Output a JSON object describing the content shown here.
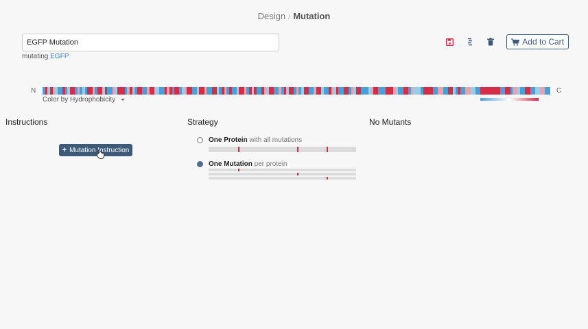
{
  "breadcrumb": {
    "parent": "Design",
    "separator": "/",
    "current": "Mutation"
  },
  "design": {
    "name_value": "EGFP Mutation",
    "mutating_prefix": "mutating",
    "mutating_target": "EGFP"
  },
  "toolbar": {
    "save_icon": "save-icon",
    "reorder_icon": "reorder-icon",
    "delete_icon": "trash-icon",
    "add_to_cart_label": "Add to Cart"
  },
  "sequence": {
    "n_label": "N",
    "c_label": "C",
    "color_by_label": "Color by Hydrophobicity",
    "colors": {
      "hydrophilic": "#4a9fd8",
      "neutral": "#ffffff",
      "hydrophobic": "#d62d46"
    },
    "pattern": "CTMTHMCCTCMTTCHCMCTTHCTTMTCCHMTTTCHTMCTTCCHTTMMCCTHTCTTCMHTTCCMTTHCCTTMCTHCTCCMTTHCTMTCCTHMTTCCHCTMTTCHCMTTCCHTTMCCTHMTCCTTCHMTTCCCMHTTCCCTTTHMCCTTCHMMMCTTTTCCHHCCTTMCTCCHHMMCCTTTTTTTTCCTTCHHMCCTTCCMMHHCC"
  },
  "columns": {
    "instructions_heading": "Instructions",
    "strategy_heading": "Strategy",
    "mutants_heading": "No Mutants"
  },
  "instructions": {
    "add_button_label": "Mutation Instruction"
  },
  "strategy": {
    "options": [
      {
        "bold": "One Protein",
        "rest": " with all mutations",
        "selected": false
      },
      {
        "bold": "One Mutation",
        "rest": " per protein",
        "selected": true
      }
    ],
    "mutation_positions": [
      0.2,
      0.6,
      0.8
    ]
  }
}
